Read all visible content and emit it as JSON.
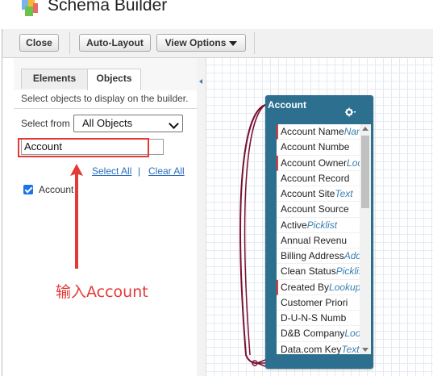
{
  "app": {
    "title": "Schema Builder",
    "logo_icon": "schema-builder-logo-icon"
  },
  "toolbar": {
    "close_label": "Close",
    "auto_layout_label": "Auto-Layout",
    "view_options_label": "View Options"
  },
  "left_panel": {
    "tabs": [
      {
        "label": "Elements",
        "active": false
      },
      {
        "label": "Objects",
        "active": true
      }
    ],
    "hint": "Select objects to display on the builder.",
    "select_from_label": "Select from",
    "select_from_value": "All Objects",
    "search_value": "Account",
    "select_all_label": "Select All",
    "separator": "|",
    "clear_all_label": "Clear All",
    "objects": [
      {
        "label": "Account",
        "checked": true
      }
    ]
  },
  "annotation": {
    "text": "输入Account",
    "color": "#e53935"
  },
  "object_card": {
    "title": "Account",
    "header_color": "#2c6f8f",
    "fields": [
      {
        "name": "Account Name",
        "type": "Name",
        "required": true
      },
      {
        "name": "Account Numbe",
        "type": "",
        "required": false
      },
      {
        "name": "Account Owner",
        "type": "Lookup",
        "required": true
      },
      {
        "name": "Account Record",
        "type": "",
        "required": false
      },
      {
        "name": "Account Site",
        "type": "Text",
        "required": false
      },
      {
        "name": "Account Source",
        "type": "",
        "required": false
      },
      {
        "name": "Active",
        "type": "Picklist",
        "required": false
      },
      {
        "name": "Annual Revenu",
        "type": "",
        "required": false
      },
      {
        "name": "Billing Address",
        "type": "Address",
        "required": false
      },
      {
        "name": "Clean Status",
        "type": "Picklist",
        "required": false
      },
      {
        "name": "Created By",
        "type": "Lookup",
        "required": true
      },
      {
        "name": "Customer Priori",
        "type": "",
        "required": false
      },
      {
        "name": "D-U-N-S Numb",
        "type": "",
        "required": false
      },
      {
        "name": "D&B Company",
        "type": "Lookup",
        "required": false
      },
      {
        "name": "Data.com Key",
        "type": "Text",
        "required": false
      }
    ]
  }
}
